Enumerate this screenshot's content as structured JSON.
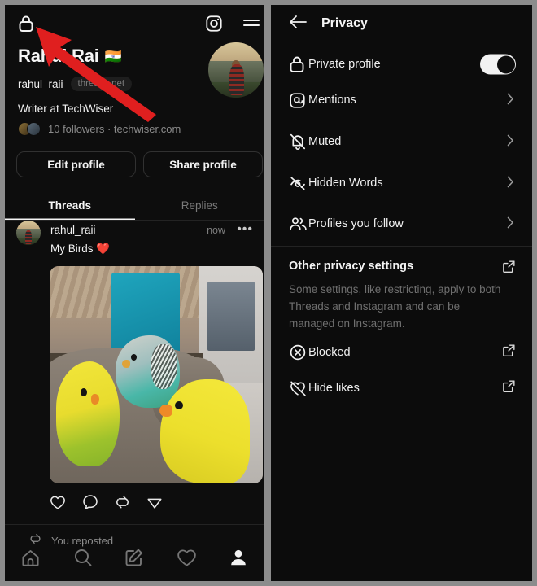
{
  "left_panel": {
    "topbar": {
      "lock_icon": "lock-icon",
      "instagram_icon": "instagram-icon",
      "menu_icon": "hamburger-menu-icon"
    },
    "profile": {
      "display_name": "Rahul Rai",
      "flag": "🇮🇳",
      "handle": "rahul_raii",
      "domain_badge": "threads.net",
      "bio": "Writer at TechWiser",
      "meta": "10 followers · techwiser.com",
      "edit_button": "Edit profile",
      "share_button": "Share profile"
    },
    "tabs": [
      {
        "label": "Threads",
        "active": true
      },
      {
        "label": "Replies",
        "active": false
      }
    ],
    "post": {
      "username": "rahul_raii",
      "time": "now",
      "more": "•••",
      "text": "My Birds ❤️",
      "image_alt": "three budgerigars perched on a grey couch",
      "actions": [
        "like-icon",
        "comment-icon",
        "repost-icon",
        "share-icon"
      ],
      "repost_label": "You reposted"
    },
    "bottom_nav": [
      {
        "name": "home",
        "icon": "home-icon"
      },
      {
        "name": "search",
        "icon": "search-icon"
      },
      {
        "name": "compose",
        "icon": "compose-icon"
      },
      {
        "name": "activity",
        "icon": "heart-icon"
      },
      {
        "name": "profile",
        "icon": "person-icon"
      }
    ]
  },
  "right_panel": {
    "header": {
      "back_icon": "back-arrow-icon",
      "title": "Privacy"
    },
    "rows": [
      {
        "label": "Private profile",
        "icon": "lock-icon",
        "control": "toggle",
        "toggle_on": true
      },
      {
        "label": "Mentions",
        "icon": "at-sign-icon",
        "control": "chevron"
      },
      {
        "label": "Muted",
        "icon": "bell-muted-icon",
        "control": "chevron"
      },
      {
        "label": "Hidden Words",
        "icon": "eye-off-icon",
        "control": "chevron"
      },
      {
        "label": "Profiles you follow",
        "icon": "people-icon",
        "control": "chevron"
      }
    ],
    "section": {
      "title": "Other privacy settings",
      "external_icon": "external-link-icon",
      "description": "Some settings, like restricting, apply to both Threads and Instagram and can be managed on Instagram."
    },
    "section_rows": [
      {
        "label": "Blocked",
        "icon": "block-circle-icon",
        "control": "external"
      },
      {
        "label": "Hide likes",
        "icon": "heart-off-icon",
        "control": "external"
      }
    ]
  },
  "annotation": {
    "arrow_color": "#e01f1f",
    "arrow_name": "red-pointer-arrow"
  },
  "colors": {
    "background": "#0d0d0d",
    "text_primary": "#f2f2f2",
    "text_secondary": "#8b8b8b",
    "divider": "#232323",
    "outer_frame": "#8c8c8c"
  }
}
